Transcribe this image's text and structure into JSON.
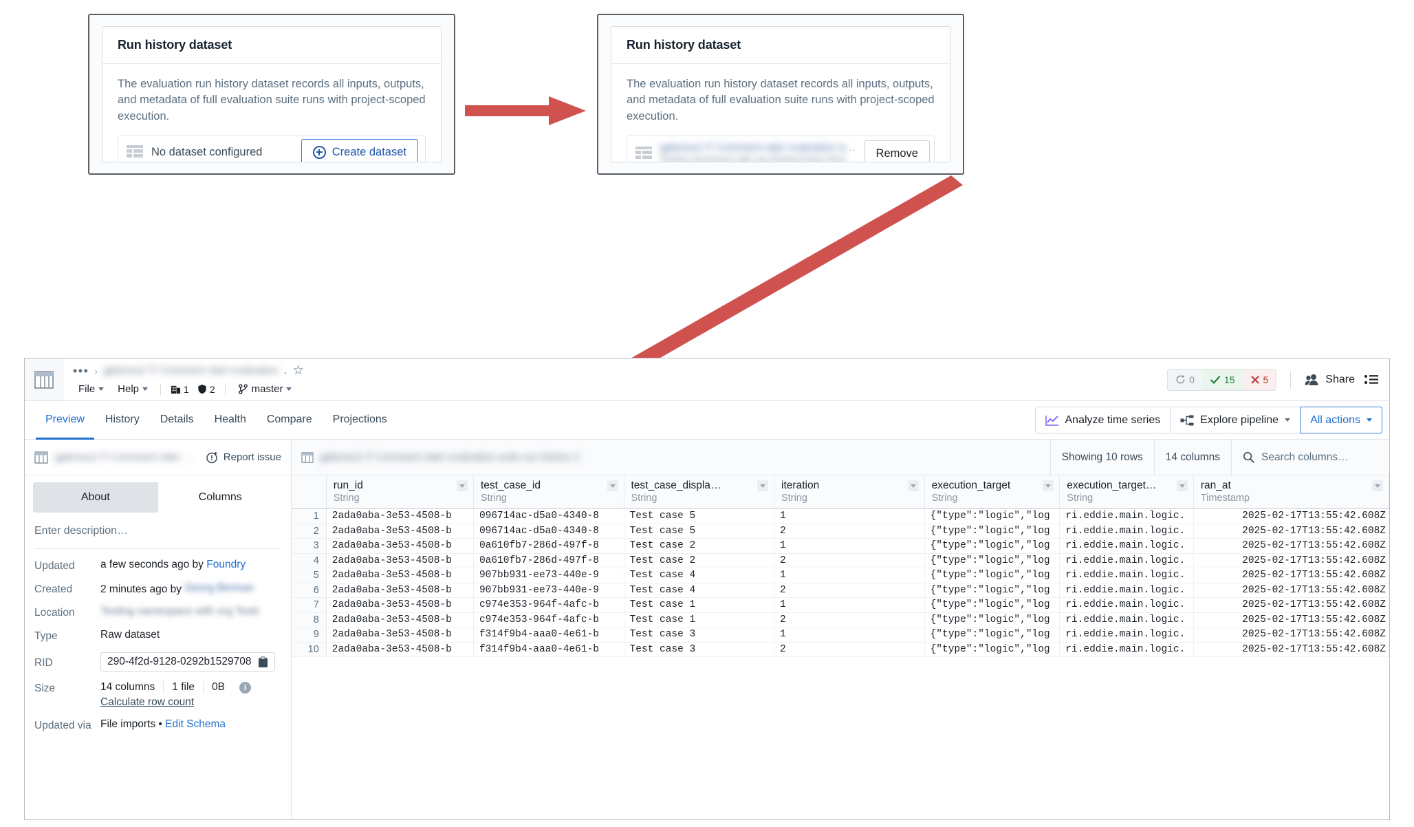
{
  "cards": {
    "before": {
      "title": "Run history dataset",
      "description": "The evaluation run history dataset records all inputs, outputs, and metadata of full evaluation suite runs with project-scoped execution.",
      "empty_label": "No dataset configured",
      "create_label": "Create dataset"
    },
    "after": {
      "title": "Run history dataset",
      "description": "The evaluation run history dataset records all inputs, outputs, and metadata of full evaluation suite runs with project-scoped execution.",
      "dataset_name_redacted": "gplensu2 IT Comment rater  evaluation suite",
      "dataset_path_redacted": "Testing namespace with org Testing Project  Storage",
      "overflow_dots": "..",
      "remove_label": "Remove"
    }
  },
  "app": {
    "breadcrumb": {
      "overflow": "•••",
      "separator": "›",
      "name_redacted": "gplensu2 IT Comment rater  evaluation",
      "suffix": ".",
      "star_icon": "star-icon"
    },
    "menu": {
      "file": "File",
      "help": "Help",
      "org_count": "1",
      "marking_count": "2",
      "branch": "master"
    },
    "status": {
      "building": "0",
      "success": "15",
      "failed": "5"
    },
    "share_label": "Share",
    "tabs": [
      {
        "label": "Preview",
        "active": true
      },
      {
        "label": "History",
        "active": false
      },
      {
        "label": "Details",
        "active": false
      },
      {
        "label": "Health",
        "active": false
      },
      {
        "label": "Compare",
        "active": false
      },
      {
        "label": "Projections",
        "active": false
      }
    ],
    "tab_actions": {
      "analyze": "Analyze time series",
      "explore": "Explore pipeline",
      "all_actions": "All actions"
    },
    "sidebar": {
      "dataset_name_redacted": "gplensu2 IT Comment rater ...",
      "report_issue": "Report issue",
      "segments": [
        {
          "label": "About",
          "active": true
        },
        {
          "label": "Columns",
          "active": false
        }
      ],
      "description_placeholder": "Enter description…",
      "meta": [
        {
          "key": "Updated",
          "value": "a few seconds ago by ",
          "link": "Foundry"
        },
        {
          "key": "Created",
          "value": "2 minutes ago by ",
          "redacted": "Georg Bennan"
        },
        {
          "key": "Location",
          "redacted_only": "Testing namespace with org Testin..."
        },
        {
          "key": "Type",
          "value": "Raw dataset"
        }
      ],
      "rid_label": "RID",
      "rid_value": "290-4f2d-9128-0292b1529708",
      "copy_icon": "clipboard-icon",
      "size_label": "Size",
      "size_columns": "14 columns",
      "size_files": "1 file",
      "size_bytes": "0B",
      "calculate_row_count": "Calculate row count",
      "updated_via_label": "Updated via",
      "updated_via_value": "File imports",
      "updated_via_sep": "•",
      "edit_schema": "Edit Schema"
    },
    "grid": {
      "dataset_path_redacted": "gplensu2 IT Comment rater  evaluation suite  run history 2",
      "showing_rows": "Showing 10 rows",
      "column_count": "14 columns",
      "search_placeholder": "Search columns…",
      "columns": [
        {
          "name": "run_id",
          "type": "String"
        },
        {
          "name": "test_case_id",
          "type": "String"
        },
        {
          "name": "test_case_displa…",
          "type": "String"
        },
        {
          "name": "iteration",
          "type": "String"
        },
        {
          "name": "execution_target",
          "type": "String"
        },
        {
          "name": "execution_target…",
          "type": "String"
        },
        {
          "name": "ran_at",
          "type": "Timestamp"
        }
      ],
      "rows": [
        {
          "n": "1",
          "run_id": "2ada0aba-3e53-4508-b",
          "test_case_id": "096714ac-d5a0-4340-8",
          "display": "Test case 5",
          "iteration": "1",
          "exec_target": "{\"type\":\"logic\",\"log",
          "exec_target2": "ri.eddie.main.logic.",
          "ran_at": "2025-02-17T13:55:42.608Z"
        },
        {
          "n": "2",
          "run_id": "2ada0aba-3e53-4508-b",
          "test_case_id": "096714ac-d5a0-4340-8",
          "display": "Test case 5",
          "iteration": "2",
          "exec_target": "{\"type\":\"logic\",\"log",
          "exec_target2": "ri.eddie.main.logic.",
          "ran_at": "2025-02-17T13:55:42.608Z"
        },
        {
          "n": "3",
          "run_id": "2ada0aba-3e53-4508-b",
          "test_case_id": "0a610fb7-286d-497f-8",
          "display": "Test case 2",
          "iteration": "1",
          "exec_target": "{\"type\":\"logic\",\"log",
          "exec_target2": "ri.eddie.main.logic.",
          "ran_at": "2025-02-17T13:55:42.608Z"
        },
        {
          "n": "4",
          "run_id": "2ada0aba-3e53-4508-b",
          "test_case_id": "0a610fb7-286d-497f-8",
          "display": "Test case 2",
          "iteration": "2",
          "exec_target": "{\"type\":\"logic\",\"log",
          "exec_target2": "ri.eddie.main.logic.",
          "ran_at": "2025-02-17T13:55:42.608Z"
        },
        {
          "n": "5",
          "run_id": "2ada0aba-3e53-4508-b",
          "test_case_id": "907bb931-ee73-440e-9",
          "display": "Test case 4",
          "iteration": "1",
          "exec_target": "{\"type\":\"logic\",\"log",
          "exec_target2": "ri.eddie.main.logic.",
          "ran_at": "2025-02-17T13:55:42.608Z"
        },
        {
          "n": "6",
          "run_id": "2ada0aba-3e53-4508-b",
          "test_case_id": "907bb931-ee73-440e-9",
          "display": "Test case 4",
          "iteration": "2",
          "exec_target": "{\"type\":\"logic\",\"log",
          "exec_target2": "ri.eddie.main.logic.",
          "ran_at": "2025-02-17T13:55:42.608Z"
        },
        {
          "n": "7",
          "run_id": "2ada0aba-3e53-4508-b",
          "test_case_id": "c974e353-964f-4afc-b",
          "display": "Test case 1",
          "iteration": "1",
          "exec_target": "{\"type\":\"logic\",\"log",
          "exec_target2": "ri.eddie.main.logic.",
          "ran_at": "2025-02-17T13:55:42.608Z"
        },
        {
          "n": "8",
          "run_id": "2ada0aba-3e53-4508-b",
          "test_case_id": "c974e353-964f-4afc-b",
          "display": "Test case 1",
          "iteration": "2",
          "exec_target": "{\"type\":\"logic\",\"log",
          "exec_target2": "ri.eddie.main.logic.",
          "ran_at": "2025-02-17T13:55:42.608Z"
        },
        {
          "n": "9",
          "run_id": "2ada0aba-3e53-4508-b",
          "test_case_id": "f314f9b4-aaa0-4e61-b",
          "display": "Test case 3",
          "iteration": "1",
          "exec_target": "{\"type\":\"logic\",\"log",
          "exec_target2": "ri.eddie.main.logic.",
          "ran_at": "2025-02-17T13:55:42.608Z"
        },
        {
          "n": "10",
          "run_id": "2ada0aba-3e53-4508-b",
          "test_case_id": "f314f9b4-aaa0-4e61-b",
          "display": "Test case 3",
          "iteration": "2",
          "exec_target": "{\"type\":\"logic\",\"log",
          "exec_target2": "ri.eddie.main.logic.",
          "ran_at": "2025-02-17T13:55:42.608Z"
        }
      ]
    }
  },
  "annotations": {
    "arrow_color": "#d0524f"
  }
}
